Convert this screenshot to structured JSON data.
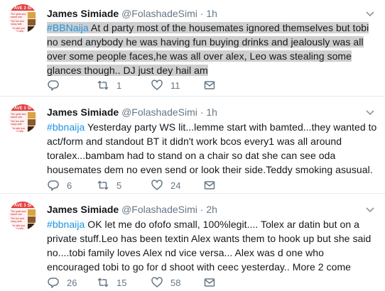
{
  "tweets": [
    {
      "name": "James Simiade",
      "handle": "@FolashadeSimi",
      "separator": "·",
      "time": "1h",
      "hashtag": "#BBNaija",
      "text": " At d party most of the housemates ignored themselves but tobi no send anybody he was having fun buying drinks and jealously was all over some people faces,he was all over alex, Leo was stealing some glances though.. DJ just dey hail am",
      "replies": "",
      "retweets": "1",
      "likes": "11",
      "highlighted": true
    },
    {
      "name": "James Simiade",
      "handle": "@FolashadeSimi",
      "separator": "·",
      "time": "1h",
      "hashtag": "#bbnaija",
      "text": " Yesterday party WS lit...lemme start with bamted...they wanted to act/form and standout BT it didn't work bcos every1 was all around toralex...bambam had to stand on a chair so dat she can see oda housemates dem no even send or look their side.Teddy smoking asusual.",
      "replies": "6",
      "retweets": "5",
      "likes": "24",
      "highlighted": false
    },
    {
      "name": "James Simiade",
      "handle": "@FolashadeSimi",
      "separator": "·",
      "time": "2h",
      "hashtag": "#bbnaija",
      "text": " OK let me do ofofo small, 100%legit.... Tolex ar datin but on a private stuff.Leo has been textin Alex wants them to hook up but she said no....tobi family loves Alex nd vice versa... Alex was d one who encouraged tobi to go for d shoot with ceec yesterday.. More 2 come",
      "replies": "26",
      "retweets": "15",
      "likes": "58",
      "highlighted": false
    }
  ],
  "avatar_text": [
    "AVE 3 SI",
    "The quiet and sweet one",
    "The fun and crazy side",
    "The side you want to see"
  ],
  "icons": {
    "reply": "reply-icon",
    "retweet": "retweet-icon",
    "like": "heart-icon",
    "dm": "envelope-icon",
    "caret": "chevron-down-icon"
  },
  "colors": {
    "text": "#14171a",
    "muted": "#657786",
    "hashtag": "#1b95e0",
    "highlight": "#cfcfcf",
    "divider": "#e6ecf0"
  }
}
